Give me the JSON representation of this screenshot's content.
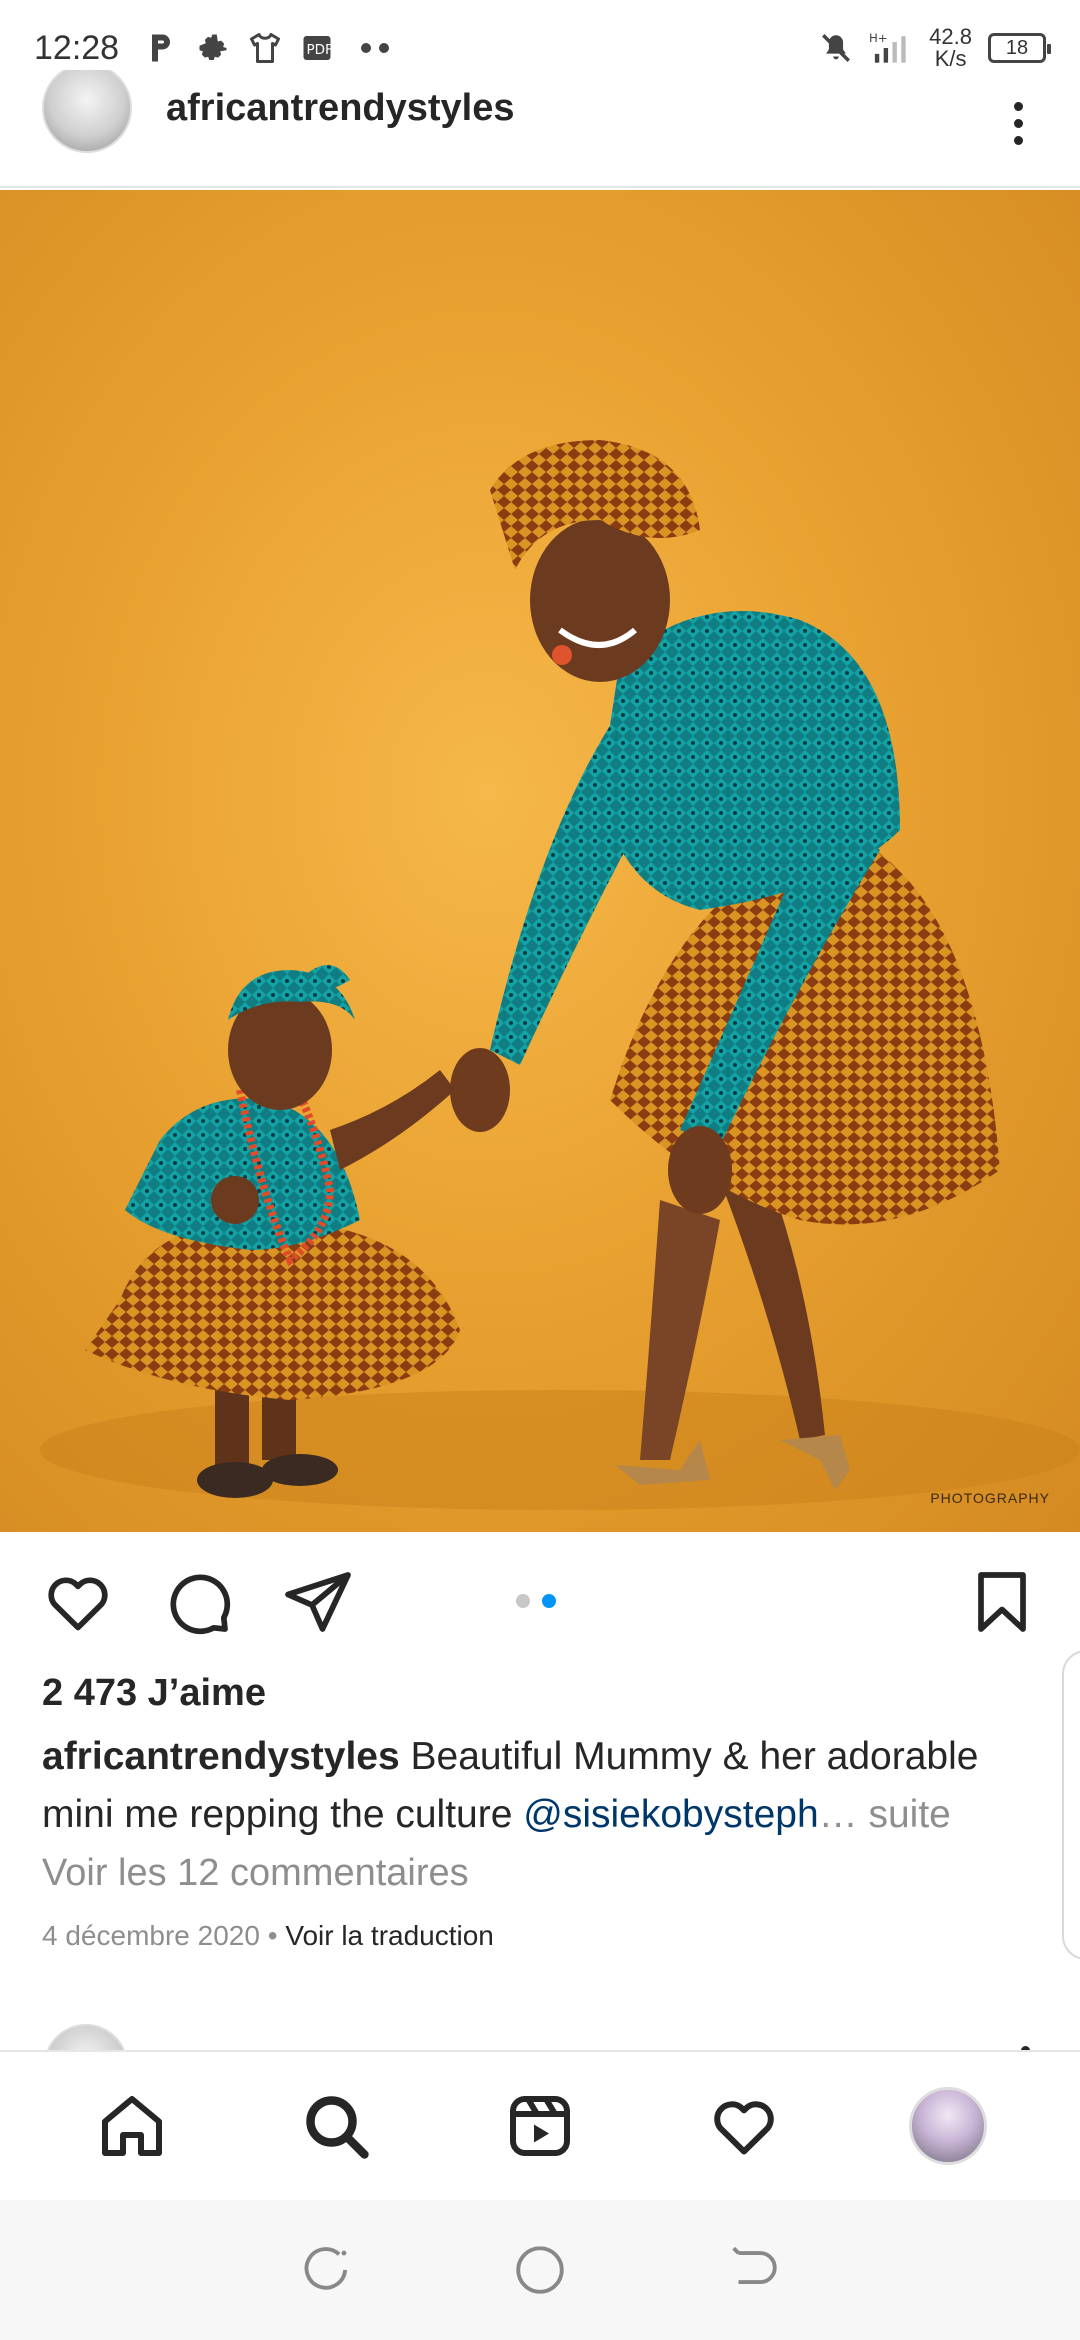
{
  "status_bar": {
    "time": "12:28",
    "left_icons": [
      "parking-icon",
      "gear-icon",
      "shirt-icon",
      "pdf-icon"
    ],
    "network": "H+",
    "speed_value": "42.8",
    "speed_unit": "K/s",
    "battery": "18"
  },
  "post": {
    "username": "africantrendystyles",
    "photo_watermark": "PHOTOGRAPHY",
    "carousel": {
      "count": 2,
      "active_index": 1,
      "active_color": "#0095f6",
      "inactive_color": "#c7c7c7"
    },
    "likes": "2 473 J’aime",
    "caption": {
      "username": "africantrendystyles",
      "text": " Beautiful Mummy & her adorable mini me repping the culture ",
      "mention": "@sisiekobysteph",
      "ellipsis": "…",
      "more": " suite"
    },
    "comments_link": "Voir les 12 commentaires",
    "date": "4 décembre 2020",
    "separator": " • ",
    "translate": "Voir la traduction"
  },
  "bottom_nav": {
    "items": [
      "home-icon",
      "search-icon",
      "reels-icon",
      "heart-icon",
      "profile-avatar"
    ]
  },
  "colors": {
    "text": "#262626",
    "muted": "#8e8e8e",
    "mention": "#00376b",
    "accent": "#0095f6"
  }
}
